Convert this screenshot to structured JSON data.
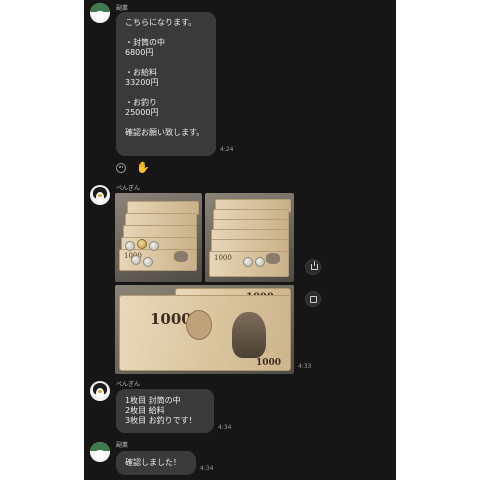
{
  "chat": {
    "messages": [
      {
        "sender": "副業",
        "avatar": "ghost-avatar",
        "text": "こちらになります。\n\n・封筒の中\n6800円\n\n・お給料\n33200円\n\n・お釣り\n25000円\n\n確認お願い致します。",
        "time": "4:24"
      },
      {
        "sender": "ぺんぎん",
        "avatar": "penguin-avatar",
        "type": "photos",
        "photo_count": 3,
        "photo_content": "1000円札と硬貨",
        "time": "4:33"
      },
      {
        "sender": "ぺんぎん",
        "avatar": "penguin-avatar",
        "text": "1枚目 封筒の中\n2枚目 給料\n3枚目 お釣りです！",
        "time": "4:34"
      },
      {
        "sender": "副業",
        "avatar": "ghost-avatar",
        "text": "確認しました！",
        "time": "4:34"
      }
    ],
    "reactions": [
      "smile-icon",
      "raised-hand-icon"
    ],
    "side_actions": [
      "share-icon",
      "expand-icon"
    ],
    "banknote_label": "1000"
  },
  "colors": {
    "background": "#161616",
    "bubble": "#3a3a3a",
    "text": "#ececec",
    "timestamp": "#9a9a9a"
  }
}
